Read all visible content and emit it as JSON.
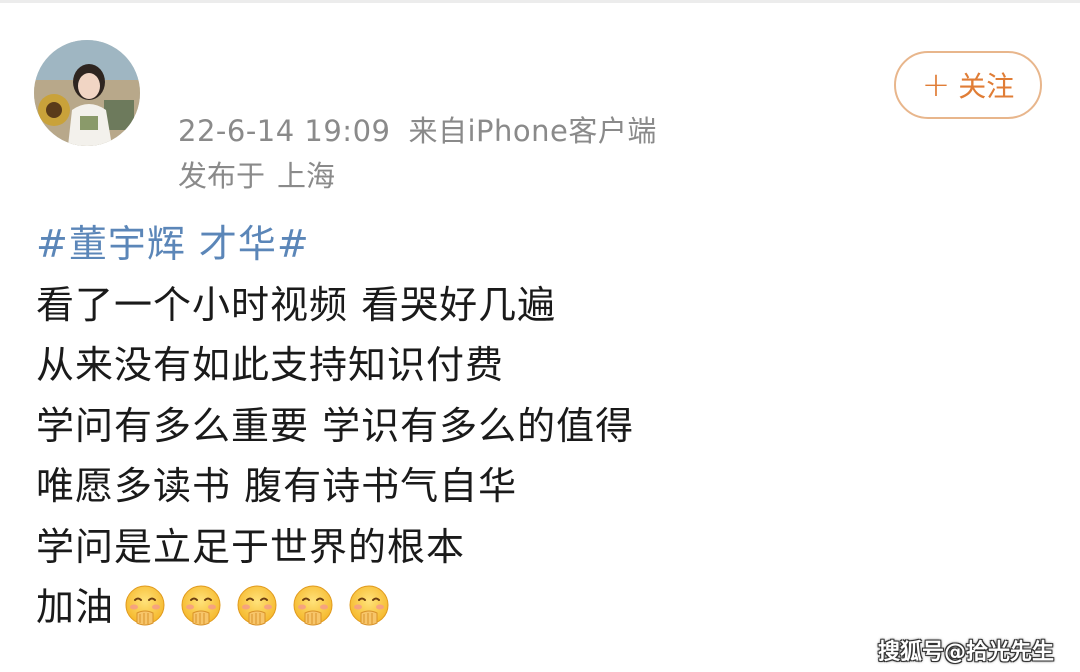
{
  "post": {
    "timestamp": "22-6-14 19:09",
    "source": "来自iPhone客户端",
    "location_label": "发布于",
    "location": "上海",
    "follow_label": "关注",
    "hashtag": "#董宇辉 才华#",
    "lines": [
      "看了一个小时视频 看哭好几遍",
      "从来没有如此支持知识付费",
      "学问有多么重要 学识有多么的值得",
      "唯愿多读书 腹有诗书气自华",
      "学问是立足于世界的根本",
      "加油"
    ],
    "emoji_icon": "face-with-hand-over-mouth-icon",
    "emoji_count": 5
  },
  "watermark": "搜狐号@拾光先生",
  "colors": {
    "hashtag": "#5b86b8",
    "follow_accent": "#e07d36",
    "meta_text": "#8a8a8a"
  }
}
